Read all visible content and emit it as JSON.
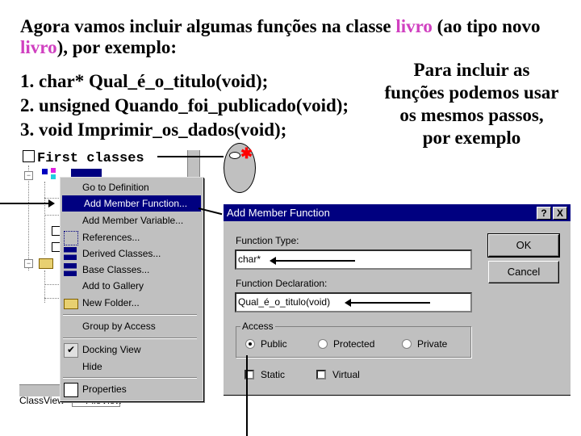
{
  "slide": {
    "heading_parts": [
      "Agora vamos incluir algumas funções na classe ",
      "livro",
      " (ao tipo novo ",
      "livro",
      "), por exemplo:"
    ],
    "accent_color": "#d040c0",
    "functions": [
      "1. char* Qual_é_o_titulo(void);",
      "2. unsigned Quando_foi_publicado(void);",
      "3. void Imprimir_os_dados(void);"
    ],
    "side_note_lines": [
      "Para incluir as",
      "funções podemos usar",
      "os mesmos passos,",
      "por exemplo"
    ]
  },
  "class_view": {
    "root_label": "First classes",
    "tabs": [
      "ClassView",
      "FileView"
    ]
  },
  "context_menu": {
    "items": [
      {
        "label": "Go to Definition",
        "icon": null
      },
      {
        "label": "Add Member Function...",
        "icon": null,
        "active": true
      },
      {
        "label": "Add Member Variable...",
        "icon": null
      },
      {
        "label": "References...",
        "icon": "references-icon"
      },
      {
        "label": "Derived Classes...",
        "icon": "derived-classes-icon"
      },
      {
        "label": "Base Classes...",
        "icon": "base-classes-icon"
      },
      {
        "label": "Add to Gallery",
        "icon": null
      },
      {
        "label": "New Folder...",
        "icon": "new-folder-icon"
      },
      {
        "label": "Group by Access",
        "icon": null
      },
      {
        "label": "Docking View",
        "icon": "checkmark-icon",
        "checked": true
      },
      {
        "label": "Hide",
        "icon": null
      },
      {
        "label": "Properties",
        "icon": "properties-icon"
      }
    ]
  },
  "dialog": {
    "title": "Add Member Function",
    "help_button": "?",
    "close_button": "X",
    "function_type_label": "Function Type:",
    "function_type_value": "char*",
    "function_declaration_label": "Function Declaration:",
    "function_declaration_value": "Qual_é_o_titulo(void)",
    "ok_label": "OK",
    "cancel_label": "Cancel",
    "access_group_label": "Access",
    "access_options": [
      "Public",
      "Protected",
      "Private"
    ],
    "access_selected": "Public",
    "static_label": "Static",
    "static_checked": false,
    "virtual_label": "Virtual",
    "virtual_checked": false
  }
}
